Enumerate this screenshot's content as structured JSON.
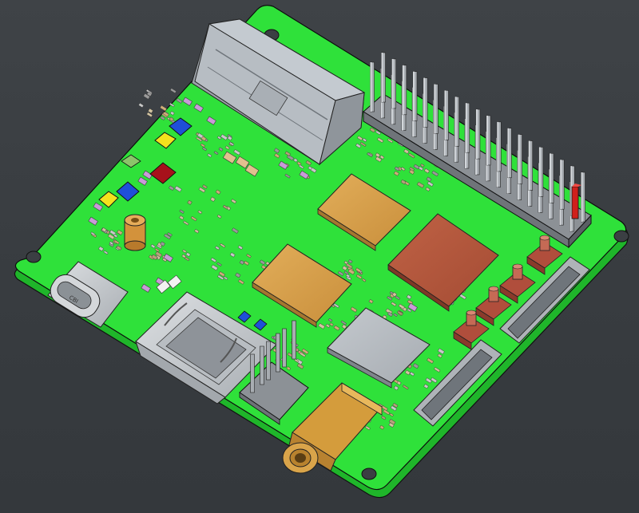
{
  "viewer": {
    "background_color": "#3b3f43"
  },
  "board": {
    "pcb_color": "#2fe13a",
    "pcb_edge_color": "#1fb52a",
    "mounting_holes": 4,
    "gpio_header_pins": 40,
    "gpio_pin1_marker_color": "#d0201c",
    "components": [
      {
        "name": "m2-connector",
        "color": "#b9bfc6"
      },
      {
        "name": "gpio-header",
        "color": "#8c9196"
      },
      {
        "name": "soc-chip",
        "color": "#b75a3f"
      },
      {
        "name": "memory-chip-1",
        "color": "#d8a04c"
      },
      {
        "name": "memory-chip-2",
        "color": "#d8a04c"
      },
      {
        "name": "emmc-chip",
        "color": "#b0b5bb"
      },
      {
        "name": "usb-c-port",
        "color": "#c8ccd0"
      },
      {
        "name": "hdmi-port",
        "color": "#c8ccd0"
      },
      {
        "name": "audio-jack",
        "color": "#d09a3a"
      },
      {
        "name": "fpc-connector-1",
        "color": "#aeb3b8"
      },
      {
        "name": "fpc-connector-2",
        "color": "#aeb3b8"
      },
      {
        "name": "tactile-button",
        "color": "#b04e3c"
      },
      {
        "name": "standoff",
        "color": "#d3923b"
      },
      {
        "name": "led-blue",
        "color": "#1f4fd8"
      },
      {
        "name": "led-yellow",
        "color": "#f3e21d"
      },
      {
        "name": "led-red",
        "color": "#a7111b"
      }
    ],
    "usb_marking": "CBI"
  }
}
